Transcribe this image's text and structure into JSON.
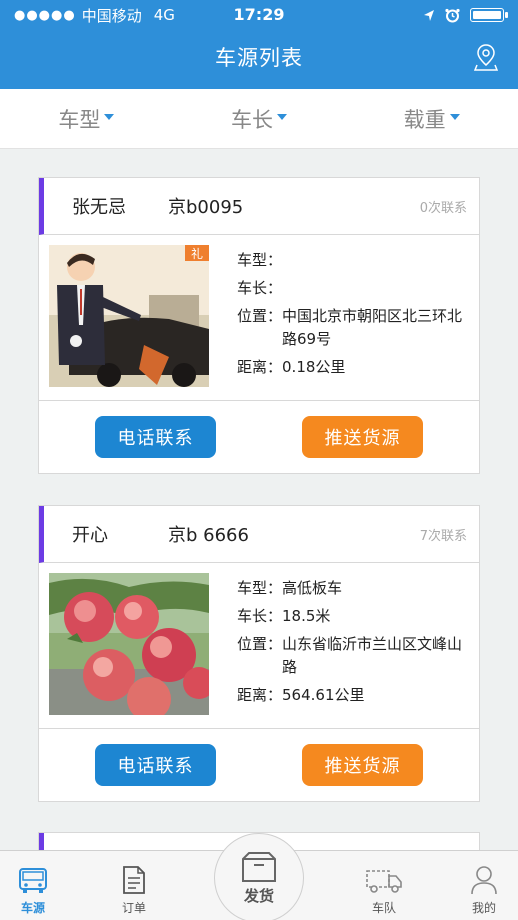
{
  "status_bar": {
    "signal": "●●●●●",
    "carrier": "中国移动",
    "network": "4G",
    "time": "17:29"
  },
  "header": {
    "title": "车源列表",
    "location_icon": "map-pin-icon"
  },
  "filters": [
    {
      "label": "车型"
    },
    {
      "label": "车长"
    },
    {
      "label": "载重"
    }
  ],
  "cards": [
    {
      "name": "张无忌",
      "plate": "京b0095",
      "contact_count": "0次联系",
      "fields": {
        "type_label": "车型：",
        "type_value": "",
        "length_label": "车长：",
        "length_value": "",
        "location_label": "位置：",
        "location_value": "中国北京市朝阳区北三环北路69号",
        "distance_label": "距离：",
        "distance_value": "0.18公里"
      },
      "image_text": "礼",
      "call_label": "电话联系",
      "push_label": "推送货源"
    },
    {
      "name": "开心",
      "plate": "京b 6666",
      "contact_count": "7次联系",
      "fields": {
        "type_label": "车型：",
        "type_value": "高低板车",
        "length_label": "车长：",
        "length_value": "18.5米",
        "location_label": "位置：",
        "location_value": "山东省临沂市兰山区文峰山路",
        "distance_label": "距离：",
        "distance_value": "564.61公里"
      },
      "call_label": "电话联系",
      "push_label": "推送货源"
    }
  ],
  "tabbar": {
    "tabs": [
      {
        "label": "车源",
        "icon": "bus-icon",
        "active": true
      },
      {
        "label": "订单",
        "icon": "document-icon",
        "active": false
      },
      {
        "label": "发货",
        "icon": "box-icon",
        "active": false
      },
      {
        "label": "车队",
        "icon": "truck-icon",
        "active": false
      },
      {
        "label": "我的",
        "icon": "user-icon",
        "active": false
      }
    ]
  },
  "colors": {
    "primary": "#2e8fd9",
    "accent_stripe": "#6c3be4",
    "call_button": "#1d86d2",
    "push_button": "#f5891f"
  }
}
